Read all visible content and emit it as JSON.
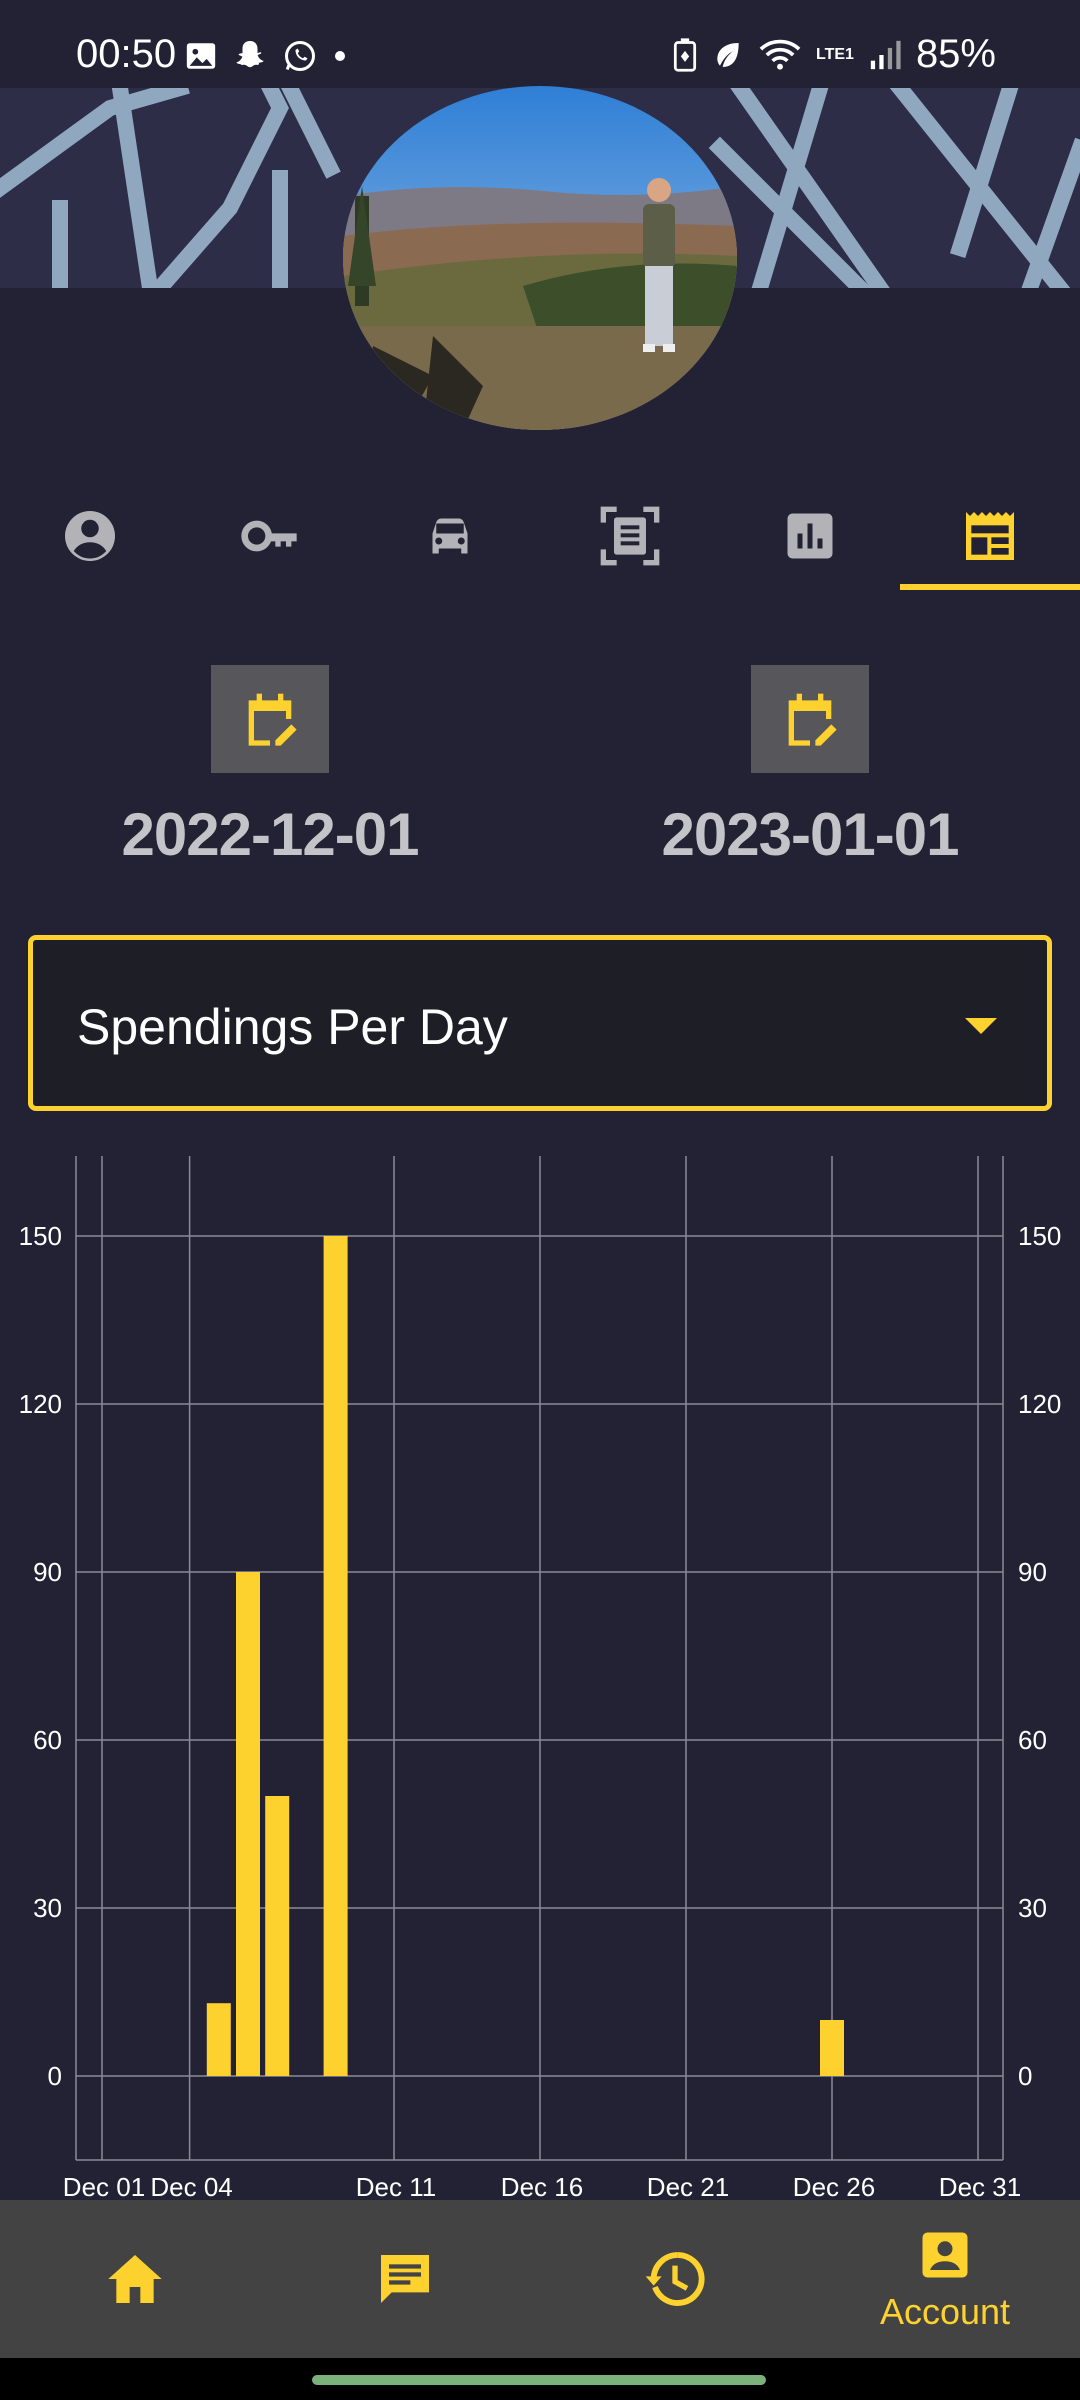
{
  "status_bar": {
    "time": "00:50",
    "battery": "85%",
    "network": "LTE1"
  },
  "tabs": [
    {
      "icon": "profile-icon",
      "selected": false
    },
    {
      "icon": "key-icon",
      "selected": false
    },
    {
      "icon": "car-icon",
      "selected": false
    },
    {
      "icon": "document-scan-icon",
      "selected": false
    },
    {
      "icon": "bar-chart-icon",
      "selected": false
    },
    {
      "icon": "table-icon",
      "selected": true
    }
  ],
  "date_range": {
    "start": "2022-12-01",
    "end": "2023-01-01"
  },
  "chart_select": {
    "selected": "Spendings Per Day"
  },
  "chart_data": {
    "type": "bar",
    "x_tick_labels": [
      "Dec 01",
      "Dec 04",
      "Dec 11",
      "Dec 16",
      "Dec 21",
      "Dec 26",
      "Dec 31"
    ],
    "y_tick_labels": [
      "0",
      "30",
      "60",
      "90",
      "120",
      "150"
    ],
    "ylim": [
      0,
      150
    ],
    "grid": true,
    "bars": [
      {
        "x": "2022-12-05",
        "value": 13
      },
      {
        "x": "2022-12-06",
        "value": 90
      },
      {
        "x": "2022-12-07",
        "value": 50
      },
      {
        "x": "2022-12-09",
        "value": 150
      },
      {
        "x": "2022-12-26",
        "value": 10
      }
    ],
    "colors": {
      "bar": "#fdd12e",
      "grid": "#8a8a96"
    }
  },
  "bottom_nav": {
    "items": [
      {
        "icon": "home-icon",
        "label": ""
      },
      {
        "icon": "chat-icon",
        "label": ""
      },
      {
        "icon": "history-icon",
        "label": ""
      },
      {
        "icon": "account-icon",
        "label": "Account"
      }
    ]
  },
  "colors": {
    "accent": "#fdd12e",
    "background": "#222234",
    "nav_background": "#434343"
  }
}
